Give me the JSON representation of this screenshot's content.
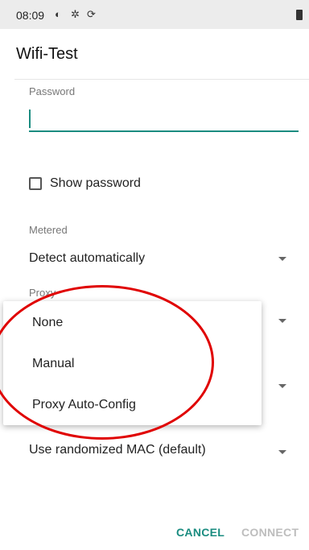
{
  "status_bar": {
    "time": "08:09",
    "icons": [
      "circle-icon",
      "gear-icon",
      "sync-icon",
      "battery-icon"
    ]
  },
  "dialog": {
    "title": "Wifi-Test",
    "password_label": "Password",
    "password_value": "",
    "show_password_label": "Show password",
    "metered_label": "Metered",
    "metered_value": "Detect automatically",
    "proxy_label": "Proxy",
    "privacy_value": "Use randomized MAC (default)"
  },
  "proxy_menu": {
    "options": [
      "None",
      "Manual",
      "Proxy Auto-Config"
    ]
  },
  "buttons": {
    "cancel": "CANCEL",
    "connect": "CONNECT"
  },
  "colors": {
    "accent": "#1a8c80",
    "annotation": "#e00000",
    "disabled": "#bdbdbd"
  }
}
